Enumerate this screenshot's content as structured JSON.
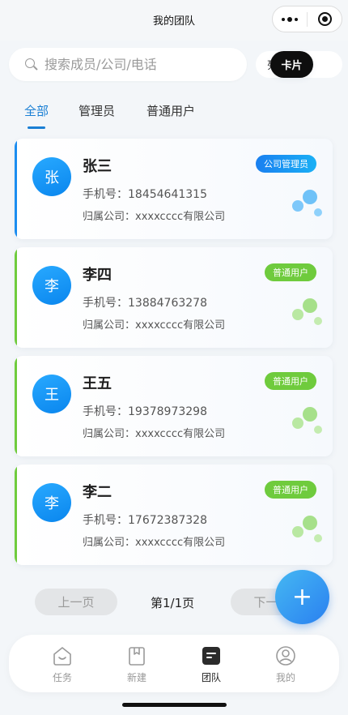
{
  "nav_bar": {
    "title": "我的团队"
  },
  "search": {
    "placeholder": "搜索成员/公司/电话"
  },
  "view_toggle": {
    "card_label": "卡片",
    "list_label": "列表",
    "selected": "卡片"
  },
  "tabs": [
    {
      "label": "全部",
      "active": true
    },
    {
      "label": "管理员",
      "active": false
    },
    {
      "label": "普通用户",
      "active": false
    }
  ],
  "members": [
    {
      "avatar_char": "张",
      "name": "张三",
      "phone": "手机号：18454641315",
      "company": "归属公司：xxxxcccc有限公司",
      "role": "公司管理员",
      "accent": "#1a8cf0"
    },
    {
      "avatar_char": "李",
      "name": "李四",
      "phone": "手机号：13884763278",
      "company": "归属公司：xxxxcccc有限公司",
      "role": "普通用户",
      "accent": "#6fcb3d"
    },
    {
      "avatar_char": "王",
      "name": "王五",
      "phone": "手机号：19378973298",
      "company": "归属公司：xxxxcccc有限公司",
      "role": "普通用户",
      "accent": "#6fcb3d"
    },
    {
      "avatar_char": "李",
      "name": "李二",
      "phone": "手机号：17672387328",
      "company": "归属公司：xxxxcccc有限公司",
      "role": "普通用户",
      "accent": "#6fcb3d"
    }
  ],
  "pagination": {
    "prev_label": "上一页",
    "page_info": "第1/1页",
    "next_label": "下一页"
  },
  "fab": {
    "icon": "plus-icon",
    "label": "+"
  },
  "tabbar": [
    {
      "label": "任务",
      "icon": "home-icon",
      "active": false
    },
    {
      "label": "新建",
      "icon": "clipboard-icon",
      "active": false
    },
    {
      "label": "团队",
      "icon": "team-doc-icon",
      "active": true
    },
    {
      "label": "我的",
      "icon": "user-icon",
      "active": false
    }
  ],
  "colors": {
    "primary": "#1a7fd4",
    "admin_badge": "#1a8cf0",
    "user_badge": "#6fcb3d"
  }
}
